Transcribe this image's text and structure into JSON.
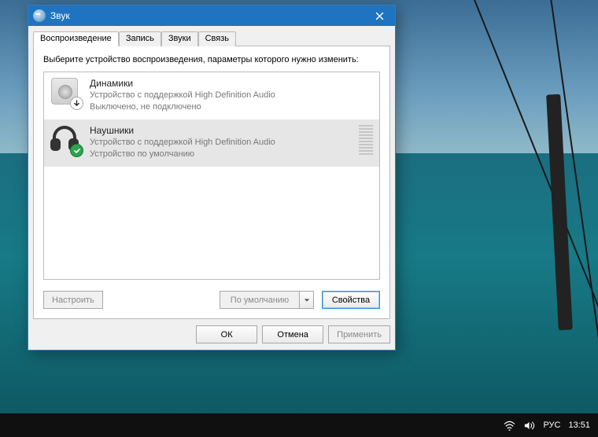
{
  "window": {
    "title": "Звук",
    "tabs": [
      {
        "label": "Воспроизведение",
        "active": true
      },
      {
        "label": "Запись"
      },
      {
        "label": "Звуки"
      },
      {
        "label": "Связь"
      }
    ],
    "instruction": "Выберите устройство воспроизведения, параметры которого нужно изменить:",
    "devices": [
      {
        "name": "Динамики",
        "line2": "Устройство с поддержкой High Definition Audio",
        "line3": "Выключено, не подключено",
        "icon": "speaker",
        "badge": "down",
        "selected": false
      },
      {
        "name": "Наушники",
        "line2": "Устройство с поддержкой High Definition Audio",
        "line3": "Устройство по умолчанию",
        "icon": "headphones",
        "badge": "ok",
        "selected": true
      }
    ],
    "buttons": {
      "configure": "Настроить",
      "set_default": "По умолчанию",
      "properties": "Свойства",
      "ok": "ОК",
      "cancel": "Отмена",
      "apply": "Применить"
    }
  },
  "taskbar": {
    "lang": "РУС",
    "time": "13:51"
  }
}
